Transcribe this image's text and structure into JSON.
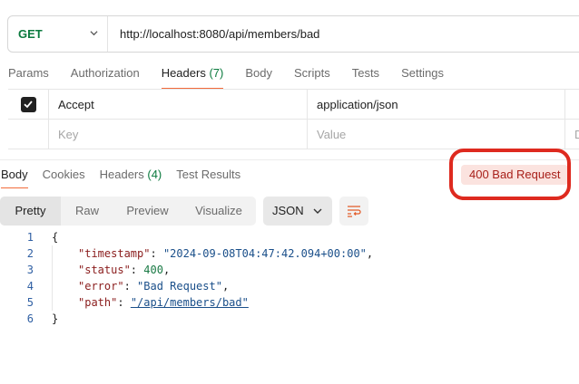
{
  "request": {
    "method": "GET",
    "url": "http://localhost:8080/api/members/bad"
  },
  "request_tabs": [
    {
      "label": "Params"
    },
    {
      "label": "Authorization"
    },
    {
      "label": "Headers",
      "count": "(7)"
    },
    {
      "label": "Body"
    },
    {
      "label": "Scripts"
    },
    {
      "label": "Tests"
    },
    {
      "label": "Settings"
    }
  ],
  "headers_table": {
    "rows": [
      {
        "key": "Accept",
        "value": "application/json",
        "checked": true
      }
    ],
    "new_row": {
      "key_placeholder": "Key",
      "value_placeholder": "Value",
      "desc_placeholder": "D"
    }
  },
  "response_tabs": [
    {
      "label": "Body"
    },
    {
      "label": "Cookies"
    },
    {
      "label": "Headers",
      "count": "(4)"
    },
    {
      "label": "Test Results"
    }
  ],
  "status": {
    "text": "400 Bad Request",
    "color": "#a8201a",
    "background": "#fbe3df",
    "highlight": "#de2a1f"
  },
  "view_modes": [
    "Pretty",
    "Raw",
    "Preview",
    "Visualize"
  ],
  "format": "JSON",
  "code": {
    "line_numbers": [
      "1",
      "2",
      "3",
      "4",
      "5",
      "6"
    ],
    "open_brace": "{",
    "close_brace": "}",
    "fields": [
      {
        "key": "\"timestamp\"",
        "value": "\"2024-09-08T04:47:42.094+00:00\"",
        "type": "string",
        "comma": ","
      },
      {
        "key": "\"status\"",
        "value": "400",
        "type": "number",
        "comma": ","
      },
      {
        "key": "\"error\"",
        "value": "\"Bad Request\"",
        "type": "string",
        "comma": ","
      },
      {
        "key": "\"path\"",
        "value": "\"/api/members/bad\"",
        "type": "link",
        "comma": ""
      }
    ]
  },
  "icons": {
    "method_dropdown": "chevron-down-icon",
    "format_dropdown": "chevron-down-icon",
    "wrap": "wrap-lines-icon",
    "checkbox": "checkmark-icon"
  }
}
